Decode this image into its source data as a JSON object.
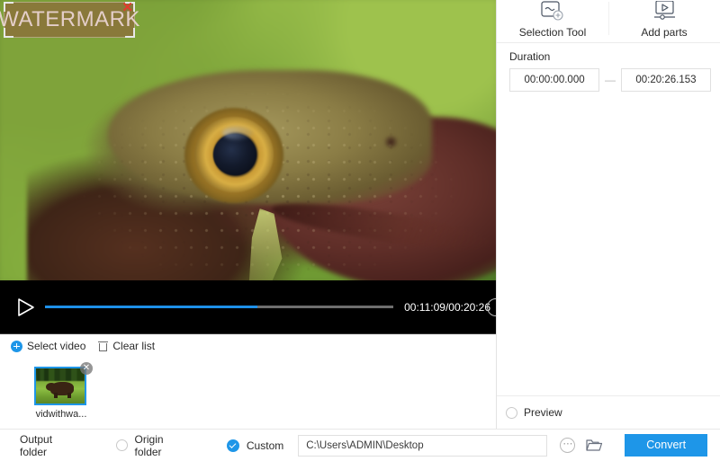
{
  "player": {
    "watermark": {
      "text": "WATERMARK",
      "close_label": "✕",
      "overlay_color": "#96463c"
    },
    "play_button_label": "play",
    "time_label": "00:11:09/00:20:26",
    "current_time": "00:11:09",
    "total_time": "00:20:26",
    "progress_percent": 61,
    "progress_color": "#1e90e8",
    "track_color": "#6e6e6e"
  },
  "list_toolbar": {
    "select_video": "Select video",
    "clear_list": "Clear list"
  },
  "thumbnail": {
    "label": "vidwithwa...",
    "close_label": "✕",
    "selected_border": "#1e96e8"
  },
  "right_panel": {
    "tools": [
      {
        "label": "Selection Tool",
        "icon": "selection-tool-icon"
      },
      {
        "label": "Add parts",
        "icon": "add-parts-icon"
      }
    ],
    "duration": {
      "title": "Duration",
      "start": "00:00:00.000",
      "end": "00:20:26.153",
      "separator": "—"
    },
    "preview": {
      "label": "Preview",
      "checked": false
    }
  },
  "bottom_bar": {
    "output_folder_label": "Output folder",
    "origin_folder_label": "Origin folder",
    "custom_label": "Custom",
    "selected_option": "Custom",
    "path_value": "C:\\Users\\ADMIN\\Desktop",
    "path_placeholder": "C:\\Users\\ADMIN\\Desktop",
    "more_label": "⋯",
    "convert_label": "Convert",
    "accent_color": "#1e96e8"
  }
}
